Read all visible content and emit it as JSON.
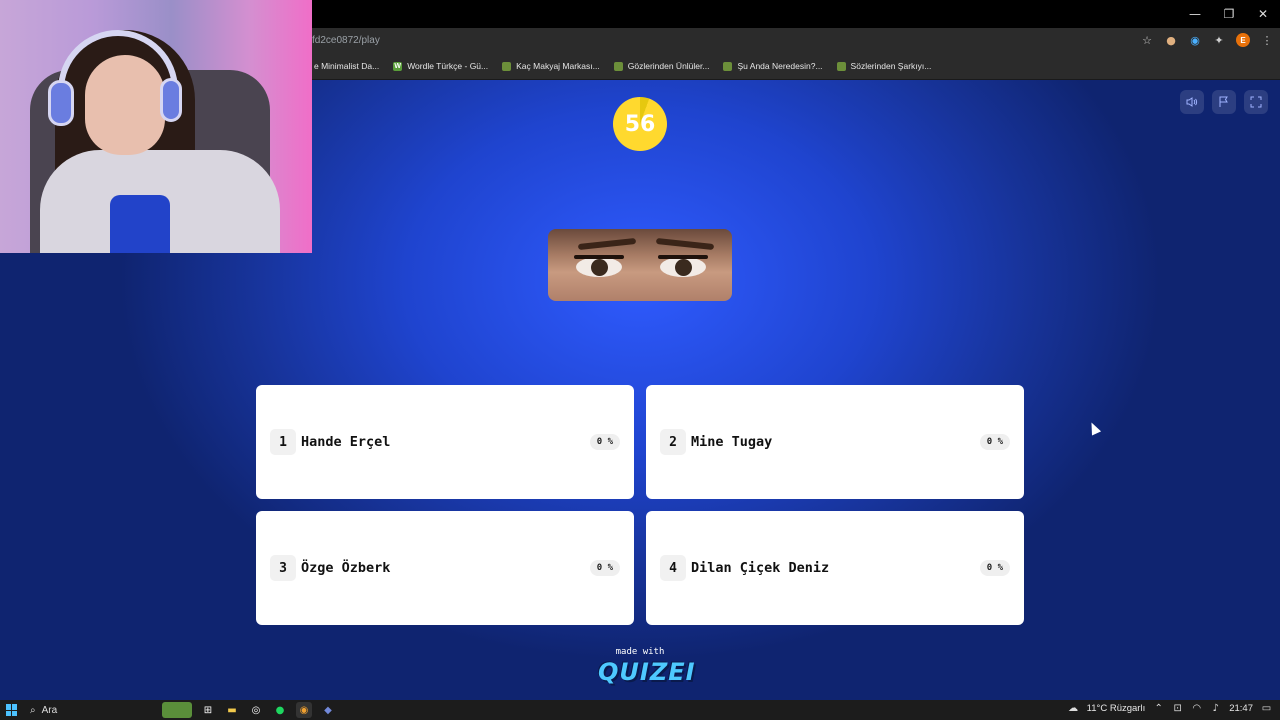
{
  "window": {
    "controls": [
      "—",
      "❐",
      "✕"
    ]
  },
  "browser": {
    "url": "fd2ce0872/play",
    "bookmarks": [
      {
        "label": "e Minimalist Da...",
        "icon": "folder-icon"
      },
      {
        "label": "Wordle Türkçe - Gü...",
        "icon": "wordle-icon"
      },
      {
        "label": "Kaç Makyaj Markası...",
        "icon": "quiz-icon"
      },
      {
        "label": "Gözlerinden Ünlüler...",
        "icon": "quiz-icon"
      },
      {
        "label": "Şu Anda Neredesin?...",
        "icon": "quiz-icon"
      },
      {
        "label": "Sözlerinden Şarkıyı...",
        "icon": "quiz-icon"
      }
    ],
    "profile_initial": "E"
  },
  "quiz": {
    "timer": "56",
    "answers": [
      {
        "number": "1",
        "text": "Hande Erçel",
        "percent": "0 %"
      },
      {
        "number": "2",
        "text": "Mine Tugay",
        "percent": "0 %"
      },
      {
        "number": "3",
        "text": "Özge Özberk",
        "percent": "0 %"
      },
      {
        "number": "4",
        "text": "Dilan Çiçek Deniz",
        "percent": "0 %"
      }
    ],
    "made_with": "made with",
    "logo": "QUIZEI"
  },
  "taskbar": {
    "search_label": "Ara",
    "weather": "11°C Rüzgarlı",
    "time": "21:47"
  },
  "colors": {
    "quiz_bg": "#1f44cf",
    "timer": "#ffd92e",
    "logo": "#4ec9ff"
  }
}
